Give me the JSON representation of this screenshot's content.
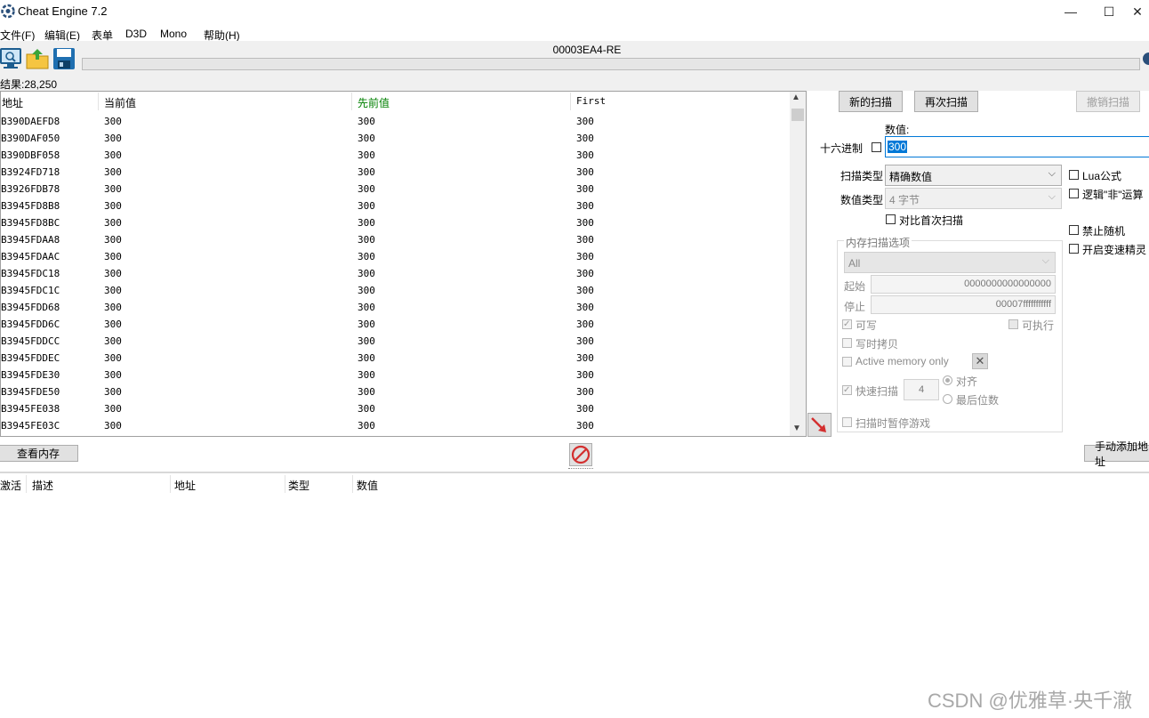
{
  "window": {
    "title": "Cheat Engine 7.2",
    "controls": {
      "minimize": "—",
      "maximize": "☐",
      "close": "✕"
    }
  },
  "menu": [
    "文件(F)",
    "编辑(E)",
    "表单",
    "D3D",
    "Mono",
    "帮助(H)"
  ],
  "toolbar": {
    "icons": [
      "open-process-icon",
      "open-file-icon",
      "save-icon"
    ],
    "process_title": "00003EA4-RE"
  },
  "found": "结果:28,250",
  "columns": {
    "address": "地址",
    "current": "当前值",
    "previous": "先前值",
    "first": "First"
  },
  "results": [
    {
      "address": "B390DAEFD8",
      "current": "300",
      "previous": "300",
      "first": "300"
    },
    {
      "address": "B390DAF050",
      "current": "300",
      "previous": "300",
      "first": "300"
    },
    {
      "address": "B390DBF058",
      "current": "300",
      "previous": "300",
      "first": "300"
    },
    {
      "address": "B3924FD718",
      "current": "300",
      "previous": "300",
      "first": "300"
    },
    {
      "address": "B3926FDB78",
      "current": "300",
      "previous": "300",
      "first": "300"
    },
    {
      "address": "B3945FD8B8",
      "current": "300",
      "previous": "300",
      "first": "300"
    },
    {
      "address": "B3945FD8BC",
      "current": "300",
      "previous": "300",
      "first": "300"
    },
    {
      "address": "B3945FDAA8",
      "current": "300",
      "previous": "300",
      "first": "300"
    },
    {
      "address": "B3945FDAAC",
      "current": "300",
      "previous": "300",
      "first": "300"
    },
    {
      "address": "B3945FDC18",
      "current": "300",
      "previous": "300",
      "first": "300"
    },
    {
      "address": "B3945FDC1C",
      "current": "300",
      "previous": "300",
      "first": "300"
    },
    {
      "address": "B3945FDD68",
      "current": "300",
      "previous": "300",
      "first": "300"
    },
    {
      "address": "B3945FDD6C",
      "current": "300",
      "previous": "300",
      "first": "300"
    },
    {
      "address": "B3945FDDCC",
      "current": "300",
      "previous": "300",
      "first": "300"
    },
    {
      "address": "B3945FDDEC",
      "current": "300",
      "previous": "300",
      "first": "300"
    },
    {
      "address": "B3945FDE30",
      "current": "300",
      "previous": "300",
      "first": "300"
    },
    {
      "address": "B3945FDE50",
      "current": "300",
      "previous": "300",
      "first": "300"
    },
    {
      "address": "B3945FE038",
      "current": "300",
      "previous": "300",
      "first": "300"
    },
    {
      "address": "B3945FE03C",
      "current": "300",
      "previous": "300",
      "first": "300"
    }
  ],
  "scan": {
    "new_scan": "新的扫描",
    "next_scan": "再次扫描",
    "undo_scan": "撤销扫描",
    "value_label": "数值:",
    "hex_label": "十六进制",
    "value": "300",
    "scan_type_label": "扫描类型",
    "scan_type": "精确数值",
    "value_type_label": "数值类型",
    "value_type": "4 字节",
    "compare_first": "对比首次扫描",
    "lua_formula": "Lua公式",
    "not_logic": "逻辑\"非\"运算",
    "no_random": "禁止随机",
    "speedhack": "开启变速精灵"
  },
  "memory_options": {
    "title": "内存扫描选项",
    "region": "All",
    "start_label": "起始",
    "start": "0000000000000000",
    "stop_label": "停止",
    "stop": "00007fffffffffff",
    "writable": "可写",
    "executable": "可执行",
    "copy_on_write": "写时拷贝",
    "active_memory": "Active memory only",
    "fast_scan": "快速扫描",
    "fast_scan_value": "4",
    "align": "对齐",
    "last_digits": "最后位数",
    "pause_game": "扫描时暂停游戏"
  },
  "bottom": {
    "view_memory": "查看内存",
    "add_address": "手动添加地址"
  },
  "cheat_columns": {
    "active": "激活",
    "description": "描述",
    "address": "地址",
    "type": "类型",
    "value": "数值"
  },
  "watermark": "CSDN @优雅草·央千澈",
  "colors": {
    "previous_header": "#008000",
    "selection": "#0078d7",
    "stop_icon": "#d32f2f",
    "arrow": "#d32f2f"
  }
}
